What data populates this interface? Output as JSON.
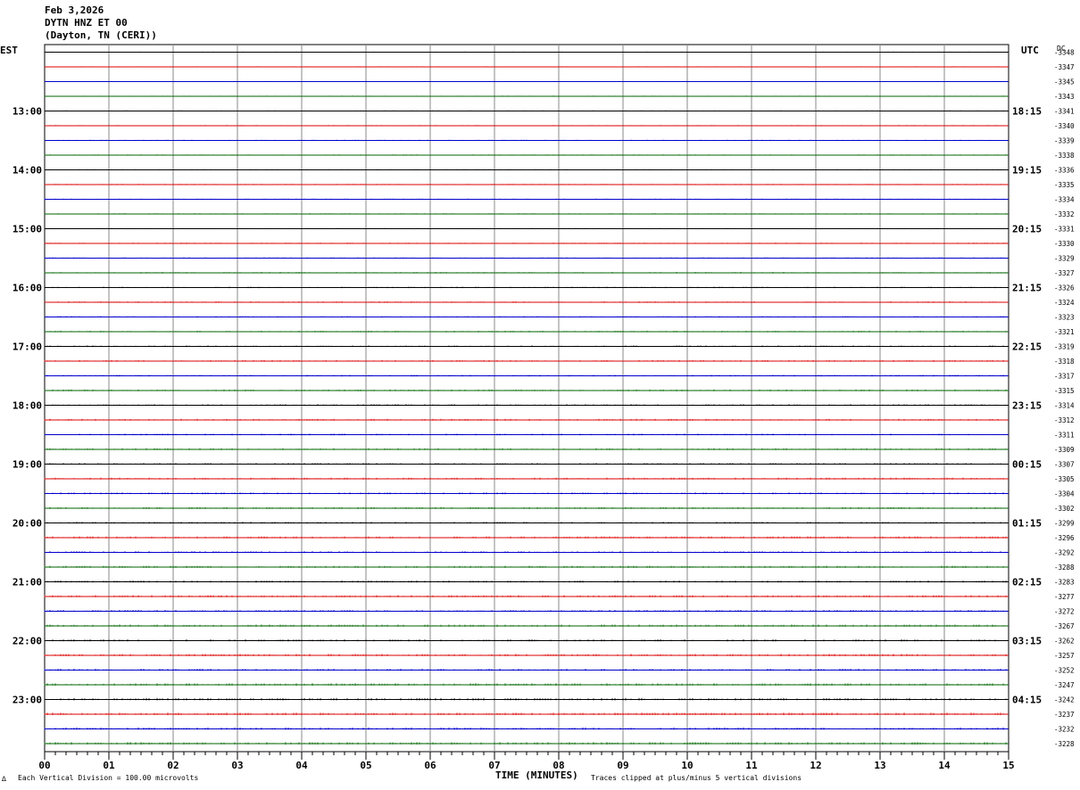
{
  "header": {
    "date": "Feb 3,2026",
    "station": "DYTN HNZ ET 00",
    "location": "(Dayton, TN (CERI))"
  },
  "left_zone_label": "EST",
  "right_zone_label": "UTC",
  "dc_label": "DC",
  "footer": {
    "scale_note": "Each Vertical Division =  100.00 microvolts",
    "xlabel": "TIME (MINUTES)",
    "clip_note": "Traces clipped at plus/minus 5 vertical divisions",
    "corner_mark": "∆"
  },
  "chart_data": {
    "type": "line",
    "title": "DYTN HNZ ET 00",
    "xlabel": "TIME (MINUTES)",
    "x_ticks": [
      "00",
      "01",
      "02",
      "03",
      "04",
      "05",
      "06",
      "07",
      "08",
      "09",
      "10",
      "11",
      "12",
      "13",
      "14",
      "15"
    ],
    "xlim": [
      0,
      15
    ],
    "trace_colors": [
      "#000000",
      "#dd0000",
      "#0000cc",
      "#006600"
    ],
    "est_hour_labels": [
      "13:00",
      "14:00",
      "15:00",
      "16:00",
      "17:00",
      "18:00",
      "19:00",
      "20:00",
      "21:00",
      "22:00",
      "23:00"
    ],
    "utc_hour_labels": [
      "18:15",
      "19:15",
      "20:15",
      "21:15",
      "22:15",
      "23:15",
      "00:15",
      "01:15",
      "02:15",
      "03:15",
      "04:15"
    ],
    "dc_offsets": [
      "-3348",
      "-3347",
      "-3345",
      "-3343",
      "-3341",
      "-3340",
      "-3339",
      "-3338",
      "-3336",
      "-3335",
      "-3334",
      "-3332",
      "-3331",
      "-3330",
      "-3329",
      "-3327",
      "-3326",
      "-3324",
      "-3323",
      "-3321",
      "-3319",
      "-3318",
      "-3317",
      "-3315",
      "-3314",
      "-3312",
      "-3311",
      "-3309",
      "-3307",
      "-3305",
      "-3304",
      "-3302",
      "-3299",
      "-3296",
      "-3292",
      "-3288",
      "-3283",
      "-3277",
      "-3272",
      "-3267",
      "-3262",
      "-3257",
      "-3252",
      "-3247",
      "-3242",
      "-3237",
      "-3232",
      "-3228"
    ],
    "grid": true
  }
}
